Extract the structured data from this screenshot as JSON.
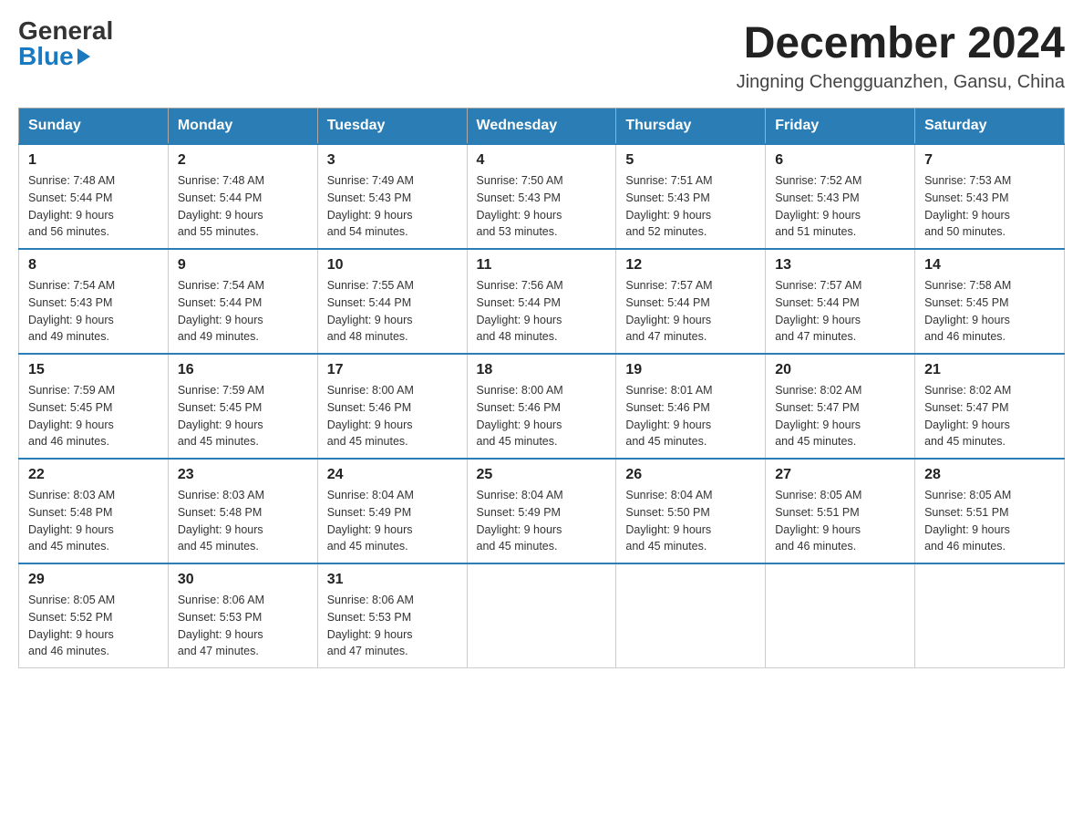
{
  "header": {
    "logo_general": "General",
    "logo_blue": "Blue",
    "title": "December 2024",
    "location": "Jingning Chengguanzhen, Gansu, China"
  },
  "days_of_week": [
    "Sunday",
    "Monday",
    "Tuesday",
    "Wednesday",
    "Thursday",
    "Friday",
    "Saturday"
  ],
  "weeks": [
    [
      {
        "day": "1",
        "sunrise": "7:48 AM",
        "sunset": "5:44 PM",
        "daylight": "9 hours and 56 minutes."
      },
      {
        "day": "2",
        "sunrise": "7:48 AM",
        "sunset": "5:44 PM",
        "daylight": "9 hours and 55 minutes."
      },
      {
        "day": "3",
        "sunrise": "7:49 AM",
        "sunset": "5:43 PM",
        "daylight": "9 hours and 54 minutes."
      },
      {
        "day": "4",
        "sunrise": "7:50 AM",
        "sunset": "5:43 PM",
        "daylight": "9 hours and 53 minutes."
      },
      {
        "day": "5",
        "sunrise": "7:51 AM",
        "sunset": "5:43 PM",
        "daylight": "9 hours and 52 minutes."
      },
      {
        "day": "6",
        "sunrise": "7:52 AM",
        "sunset": "5:43 PM",
        "daylight": "9 hours and 51 minutes."
      },
      {
        "day": "7",
        "sunrise": "7:53 AM",
        "sunset": "5:43 PM",
        "daylight": "9 hours and 50 minutes."
      }
    ],
    [
      {
        "day": "8",
        "sunrise": "7:54 AM",
        "sunset": "5:43 PM",
        "daylight": "9 hours and 49 minutes."
      },
      {
        "day": "9",
        "sunrise": "7:54 AM",
        "sunset": "5:44 PM",
        "daylight": "9 hours and 49 minutes."
      },
      {
        "day": "10",
        "sunrise": "7:55 AM",
        "sunset": "5:44 PM",
        "daylight": "9 hours and 48 minutes."
      },
      {
        "day": "11",
        "sunrise": "7:56 AM",
        "sunset": "5:44 PM",
        "daylight": "9 hours and 48 minutes."
      },
      {
        "day": "12",
        "sunrise": "7:57 AM",
        "sunset": "5:44 PM",
        "daylight": "9 hours and 47 minutes."
      },
      {
        "day": "13",
        "sunrise": "7:57 AM",
        "sunset": "5:44 PM",
        "daylight": "9 hours and 47 minutes."
      },
      {
        "day": "14",
        "sunrise": "7:58 AM",
        "sunset": "5:45 PM",
        "daylight": "9 hours and 46 minutes."
      }
    ],
    [
      {
        "day": "15",
        "sunrise": "7:59 AM",
        "sunset": "5:45 PM",
        "daylight": "9 hours and 46 minutes."
      },
      {
        "day": "16",
        "sunrise": "7:59 AM",
        "sunset": "5:45 PM",
        "daylight": "9 hours and 45 minutes."
      },
      {
        "day": "17",
        "sunrise": "8:00 AM",
        "sunset": "5:46 PM",
        "daylight": "9 hours and 45 minutes."
      },
      {
        "day": "18",
        "sunrise": "8:00 AM",
        "sunset": "5:46 PM",
        "daylight": "9 hours and 45 minutes."
      },
      {
        "day": "19",
        "sunrise": "8:01 AM",
        "sunset": "5:46 PM",
        "daylight": "9 hours and 45 minutes."
      },
      {
        "day": "20",
        "sunrise": "8:02 AM",
        "sunset": "5:47 PM",
        "daylight": "9 hours and 45 minutes."
      },
      {
        "day": "21",
        "sunrise": "8:02 AM",
        "sunset": "5:47 PM",
        "daylight": "9 hours and 45 minutes."
      }
    ],
    [
      {
        "day": "22",
        "sunrise": "8:03 AM",
        "sunset": "5:48 PM",
        "daylight": "9 hours and 45 minutes."
      },
      {
        "day": "23",
        "sunrise": "8:03 AM",
        "sunset": "5:48 PM",
        "daylight": "9 hours and 45 minutes."
      },
      {
        "day": "24",
        "sunrise": "8:04 AM",
        "sunset": "5:49 PM",
        "daylight": "9 hours and 45 minutes."
      },
      {
        "day": "25",
        "sunrise": "8:04 AM",
        "sunset": "5:49 PM",
        "daylight": "9 hours and 45 minutes."
      },
      {
        "day": "26",
        "sunrise": "8:04 AM",
        "sunset": "5:50 PM",
        "daylight": "9 hours and 45 minutes."
      },
      {
        "day": "27",
        "sunrise": "8:05 AM",
        "sunset": "5:51 PM",
        "daylight": "9 hours and 46 minutes."
      },
      {
        "day": "28",
        "sunrise": "8:05 AM",
        "sunset": "5:51 PM",
        "daylight": "9 hours and 46 minutes."
      }
    ],
    [
      {
        "day": "29",
        "sunrise": "8:05 AM",
        "sunset": "5:52 PM",
        "daylight": "9 hours and 46 minutes."
      },
      {
        "day": "30",
        "sunrise": "8:06 AM",
        "sunset": "5:53 PM",
        "daylight": "9 hours and 47 minutes."
      },
      {
        "day": "31",
        "sunrise": "8:06 AM",
        "sunset": "5:53 PM",
        "daylight": "9 hours and 47 minutes."
      },
      null,
      null,
      null,
      null
    ]
  ]
}
